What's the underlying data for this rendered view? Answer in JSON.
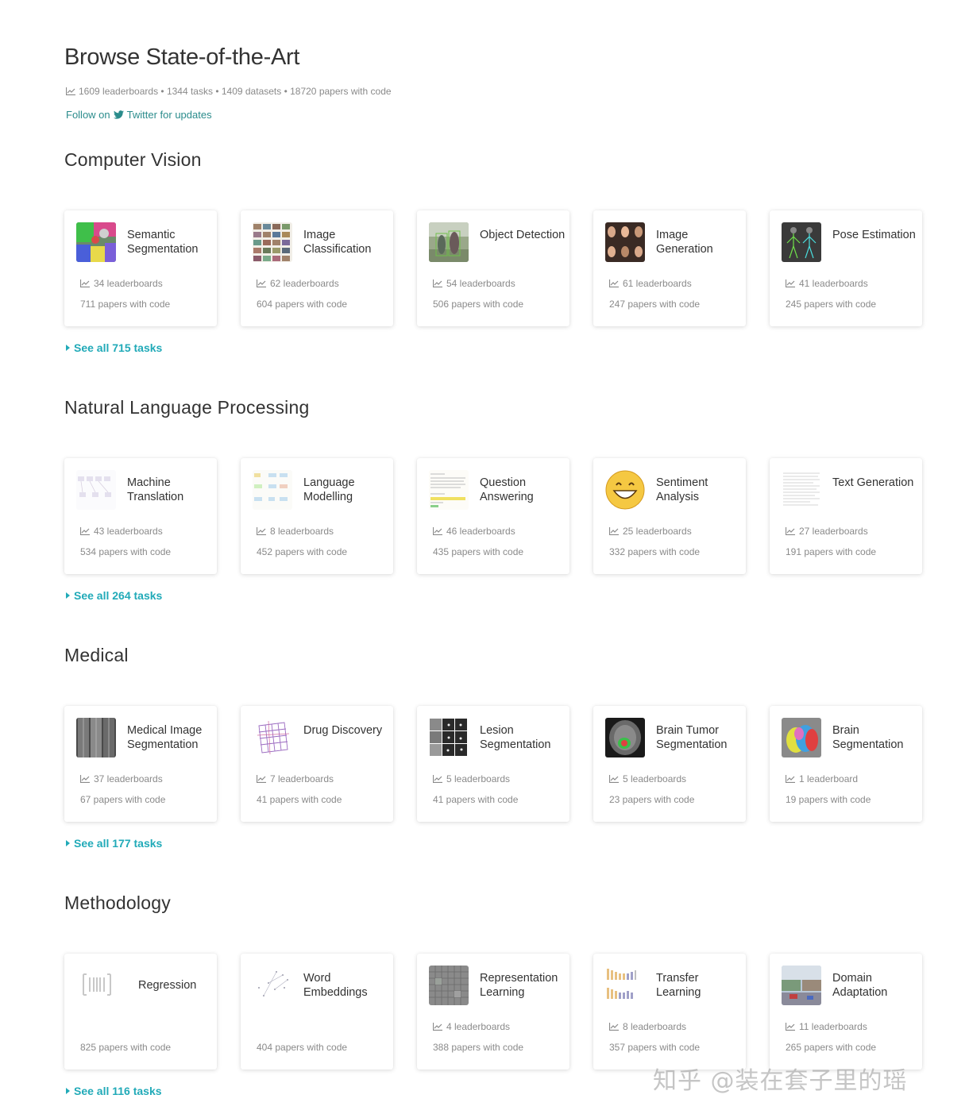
{
  "header": {
    "title": "Browse State-of-the-Art",
    "stats": "1609 leaderboards • 1344 tasks • 1409 datasets • 18720 papers with code",
    "follow_prefix": "Follow on",
    "follow_suffix": "Twitter for updates"
  },
  "sections": [
    {
      "title": "Computer Vision",
      "see_all": "See all 715 tasks",
      "cards": [
        {
          "title": "Semantic Segmentation",
          "leaderboards": "34 leaderboards",
          "papers": "711 papers with code",
          "icon": "semantic-segmentation-thumbnail"
        },
        {
          "title": "Image Classification",
          "leaderboards": "62 leaderboards",
          "papers": "604 papers with code",
          "icon": "image-classification-thumbnail"
        },
        {
          "title": "Object Detection",
          "leaderboards": "54 leaderboards",
          "papers": "506 papers with code",
          "icon": "object-detection-thumbnail"
        },
        {
          "title": "Image Generation",
          "leaderboards": "61 leaderboards",
          "papers": "247 papers with code",
          "icon": "image-generation-thumbnail"
        },
        {
          "title": "Pose Estimation",
          "leaderboards": "41 leaderboards",
          "papers": "245 papers with code",
          "icon": "pose-estimation-thumbnail"
        }
      ]
    },
    {
      "title": "Natural Language Processing",
      "see_all": "See all 264 tasks",
      "cards": [
        {
          "title": "Machine Translation",
          "leaderboards": "43 leaderboards",
          "papers": "534 papers with code",
          "icon": "machine-translation-thumbnail"
        },
        {
          "title": "Language Modelling",
          "leaderboards": "8 leaderboards",
          "papers": "452 papers with code",
          "icon": "language-modelling-thumbnail"
        },
        {
          "title": "Question Answering",
          "leaderboards": "46 leaderboards",
          "papers": "435 papers with code",
          "icon": "question-answering-thumbnail"
        },
        {
          "title": "Sentiment Analysis",
          "leaderboards": "25 leaderboards",
          "papers": "332 papers with code",
          "icon": "smiley-emoji-thumbnail"
        },
        {
          "title": "Text Generation",
          "leaderboards": "27 leaderboards",
          "papers": "191 papers with code",
          "icon": "text-generation-thumbnail"
        }
      ]
    },
    {
      "title": "Medical",
      "see_all": "See all 177 tasks",
      "cards": [
        {
          "title": "Medical Image Segmentation",
          "leaderboards": "37 leaderboards",
          "papers": "67 papers with code",
          "icon": "medical-scan-thumbnail"
        },
        {
          "title": "Drug Discovery",
          "leaderboards": "7 leaderboards",
          "papers": "41 papers with code",
          "icon": "drug-discovery-thumbnail"
        },
        {
          "title": "Lesion Segmentation",
          "leaderboards": "5 leaderboards",
          "papers": "41 papers with code",
          "icon": "lesion-grid-thumbnail"
        },
        {
          "title": "Brain Tumor Segmentation",
          "leaderboards": "5 leaderboards",
          "papers": "23 papers with code",
          "icon": "brain-tumor-thumbnail"
        },
        {
          "title": "Brain Segmentation",
          "leaderboards": "1 leaderboard",
          "papers": "19 papers with code",
          "icon": "brain-segmentation-thumbnail"
        }
      ]
    },
    {
      "title": "Methodology",
      "see_all": "See all 116 tasks",
      "cards": [
        {
          "title": "Regression",
          "leaderboards": "",
          "papers": "825 papers with code",
          "icon": "barcode-icon"
        },
        {
          "title": "Word Embeddings",
          "leaderboards": "",
          "papers": "404 papers with code",
          "icon": "word-embeddings-thumbnail"
        },
        {
          "title": "Representation Learning",
          "leaderboards": "4 leaderboards",
          "papers": "388 papers with code",
          "icon": "representation-learning-thumbnail"
        },
        {
          "title": "Transfer Learning",
          "leaderboards": "8 leaderboards",
          "papers": "357 papers with code",
          "icon": "transfer-learning-thumbnail"
        },
        {
          "title": "Domain Adaptation",
          "leaderboards": "11 leaderboards",
          "papers": "265 papers with code",
          "icon": "domain-adaptation-thumbnail"
        }
      ]
    }
  ],
  "watermark": "知乎 @装在套子里的瑶",
  "colors": {
    "accent": "#21aab8",
    "follow_link": "#2b8c8c",
    "muted": "#8a8a8a"
  }
}
